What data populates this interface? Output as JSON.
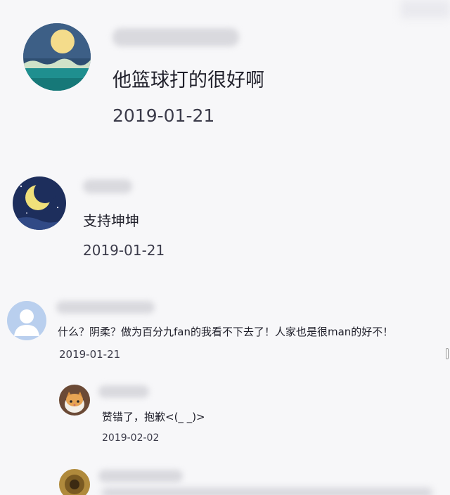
{
  "comments": [
    {
      "avatar_icon": "moon-over-sea-avatar-icon",
      "text": "他篮球打的很好啊",
      "date": "2019-01-21"
    },
    {
      "avatar_icon": "crescent-moon-avatar-icon",
      "text": "支持坤坤",
      "date": "2019-01-21"
    },
    {
      "avatar_icon": "default-user-avatar-icon",
      "text": "什么？阴柔？做为百分九fan的我看不下去了！人家也是很man的好不！",
      "date": "2019-01-21"
    }
  ],
  "replies": [
    {
      "avatar_icon": "cat-photo-avatar-icon",
      "text": "赞错了，抱歉<(_ _)>",
      "date": "2019-02-02"
    },
    {
      "avatar_icon": "profile-photo-avatar-icon"
    }
  ],
  "colors": {
    "background": "#f7f7f9",
    "text": "#1f1f2a",
    "date": "#3b3b4a"
  }
}
